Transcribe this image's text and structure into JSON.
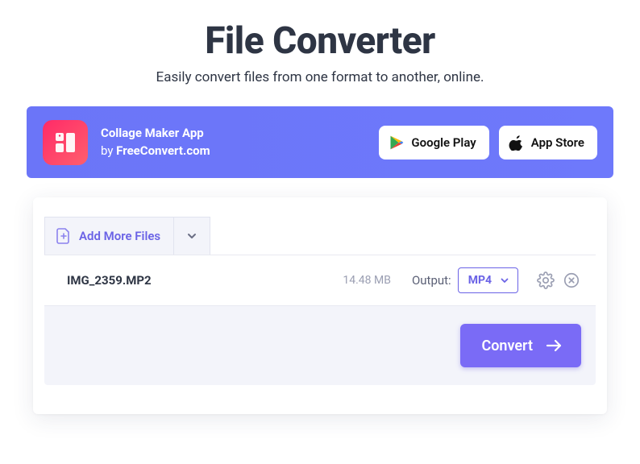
{
  "header": {
    "title": "File Converter",
    "subtitle": "Easily convert files from one format to another, online."
  },
  "promo": {
    "app_name": "Collage Maker App",
    "byline_prefix": "by ",
    "brand": "FreeConvert.com",
    "google_play": "Google Play",
    "app_store": "App Store"
  },
  "panel": {
    "add_more": "Add More Files",
    "output_label": "Output:",
    "convert": "Convert"
  },
  "file": {
    "name": "IMG_2359.MP2",
    "size": "14.48 MB",
    "output_format": "MP4"
  }
}
